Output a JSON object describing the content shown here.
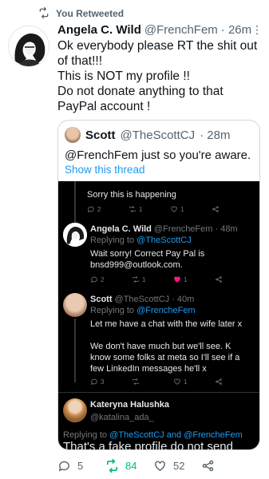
{
  "retweet_context": {
    "label": "You Retweeted"
  },
  "tweet": {
    "author_name": "Angela C. Wild",
    "author_handle": "@FrenchFem",
    "time": "· 26m",
    "more_label": "⋮",
    "text": "Ok everybody please RT the shit out of that!!!\nThis is NOT my profile !!\nDo not donate anything to that PayPal account !"
  },
  "quote": {
    "author_name": "Scott",
    "author_handle": "@TheScottCJ",
    "time": "· 28m",
    "text": "@FrenchFem just so you're aware.",
    "show_thread": "Show this thread",
    "screenshot": {
      "top_text": "Sorry this is happening",
      "top_actions": {
        "reply": "2",
        "retweet": "1",
        "like": "1"
      },
      "reply1": {
        "name": "Angela C. Wild",
        "handle": "@FrencheFem · 48m",
        "replying_prefix": "Replying to",
        "replying_to": "@TheScottCJ",
        "text": "Wait sorry! Correct Pay Pal is\nbnsd999@outlook.com.",
        "reply_count": "2",
        "retweet_count": "1",
        "like_count": "1"
      },
      "reply2": {
        "name": "Scott",
        "handle": "@TheScottCJ · 40m",
        "replying_prefix": "Replying to",
        "replying_to": "@FrencheFem",
        "text": "Let me have a chat with the wife later x\n\nWe don't have much but we'll see. K\nknow some folks at meta so I'll see if a\nfew LinkedIn messages he'll x",
        "reply_count": "3",
        "retweet_count": "",
        "like_count": "1"
      },
      "reply3": {
        "name": "Kateryna Halushka",
        "handle": "@katalina_ada_",
        "replying_prefix": "Replying to",
        "replying_to": "@TheScottCJ and @FrencheFem",
        "text": "That's a fake profile do not send"
      }
    }
  },
  "actions": {
    "replies": "5",
    "retweets": "84",
    "likes": "52"
  },
  "colors": {
    "accent": "#1d9bf0",
    "retweet_green": "#00ba7c",
    "like_pink": "#f91880",
    "secondary_text": "#536471"
  }
}
